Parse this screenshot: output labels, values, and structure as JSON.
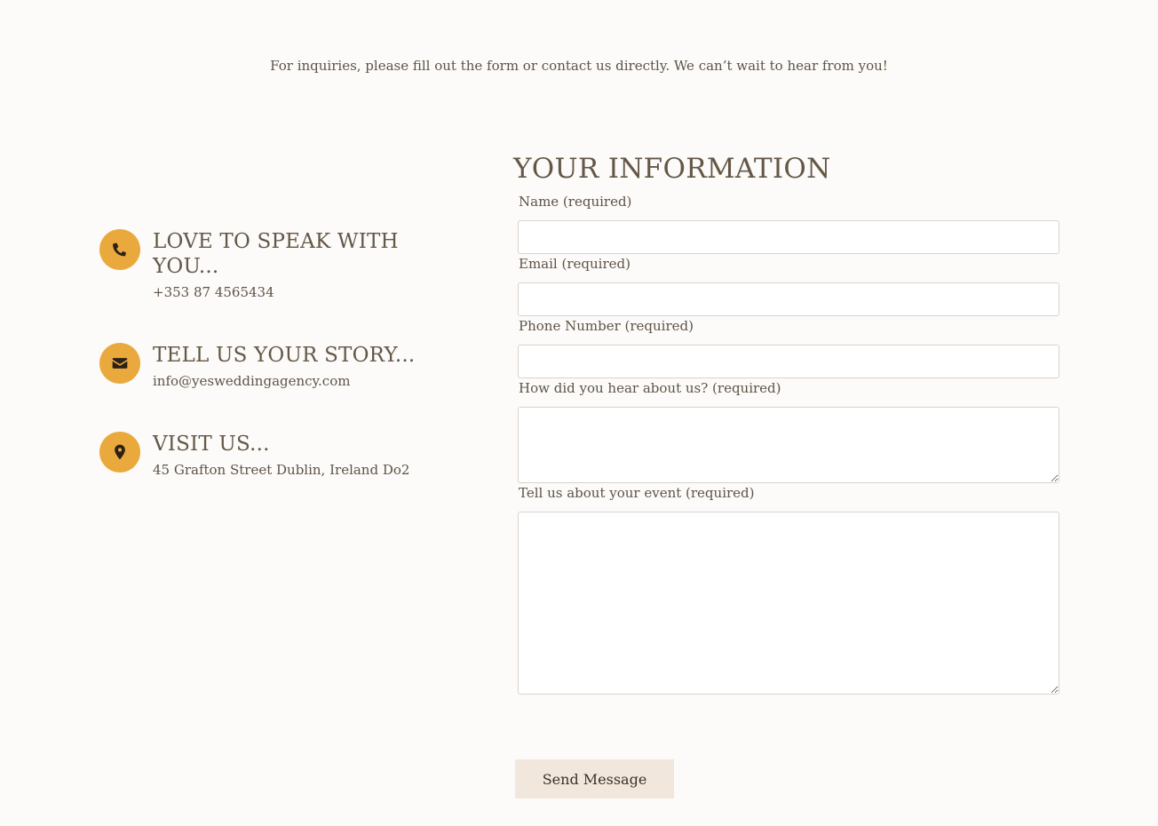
{
  "intro": {
    "text": "For inquiries, please fill out the form or contact us directly. We can’t wait to hear from you!"
  },
  "contact": {
    "items": [
      {
        "heading": "LOVE TO SPEAK WITH YOU...",
        "detail": "+353 87 4565434",
        "icon": "phone-icon"
      },
      {
        "heading": "TELL US YOUR STORY...",
        "detail": "info@yesweddingagency.com",
        "icon": "envelope-icon"
      },
      {
        "heading": "VISIT US...",
        "detail": "45 Grafton Street Dublin, Ireland Do2",
        "icon": "map-pin-icon"
      }
    ],
    "icon_bg": "#eaa93c",
    "icon_fg": "#2b2118"
  },
  "form": {
    "title": "YOUR INFORMATION",
    "fields": [
      {
        "label": "Name (required)",
        "value": ""
      },
      {
        "label": "Email (required)",
        "value": ""
      },
      {
        "label": "Phone Number (required)",
        "value": ""
      },
      {
        "label": "How did you hear about us? (required)",
        "value": ""
      },
      {
        "label": "Tell us about your event (required)",
        "value": ""
      }
    ],
    "submit_label": "Send Message",
    "submit_bg": "#f1e7dc"
  }
}
